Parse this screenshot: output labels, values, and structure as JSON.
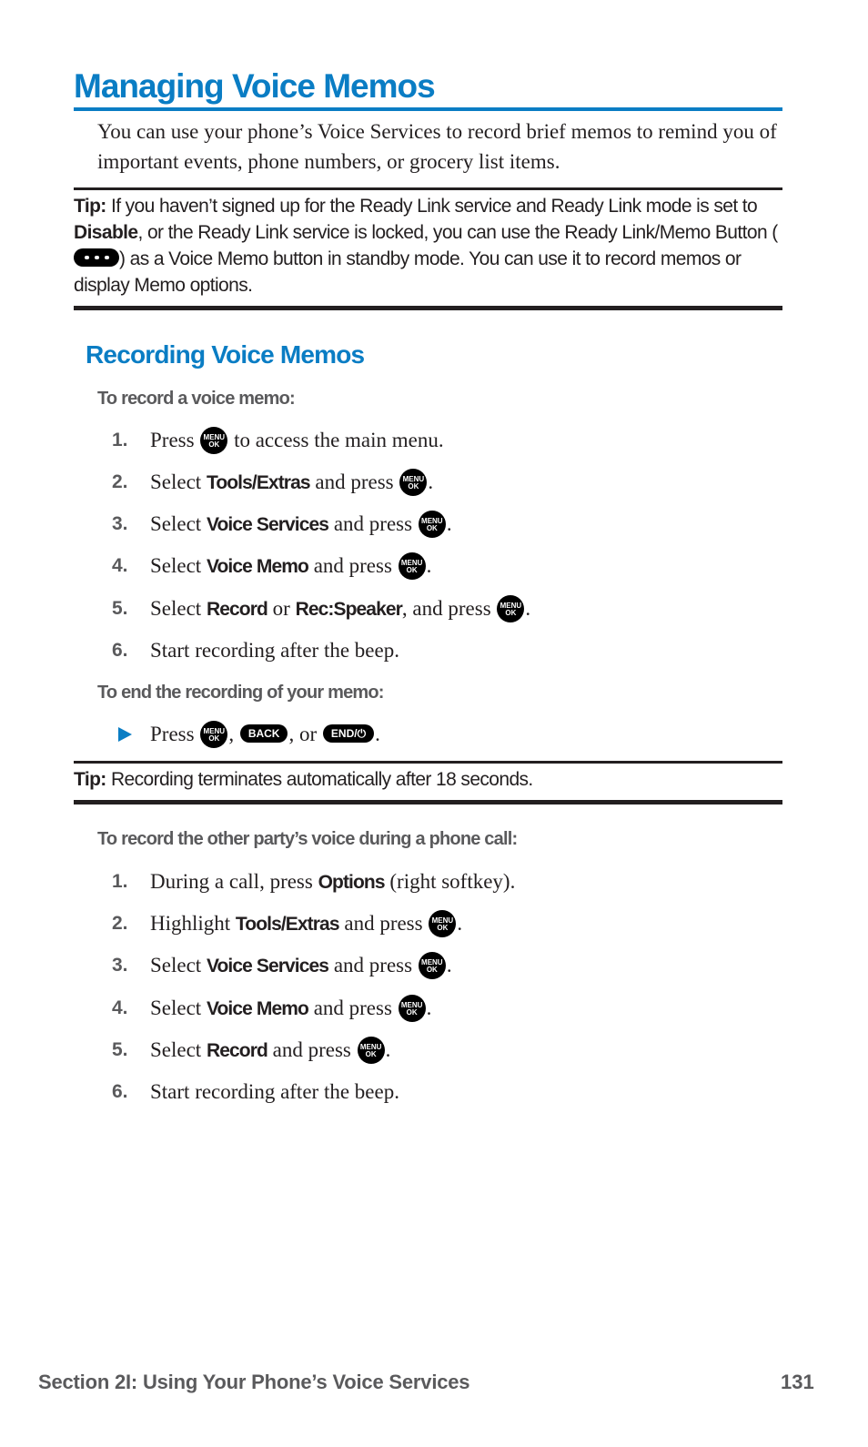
{
  "title": "Managing Voice Memos",
  "intro": "You can use your phone’s Voice Services to record brief memos to remind you of important events, phone numbers, or grocery list items.",
  "tip1": {
    "label": "Tip:",
    "part1": " If you haven’t signed up for the Ready Link service and Ready Link mode is set to ",
    "bold": "Disable",
    "part2": ", or the Ready Link service is locked, you can use the Ready Link/Memo Button (",
    "key_icon": "ready-link-memo-button-icon",
    "part3": ") as a Voice Memo button in standby mode. You can use it to record memos or display Memo options."
  },
  "section_heading": "Recording Voice Memos",
  "record": {
    "subheading": "To record a voice memo:",
    "steps": [
      {
        "num": "1.",
        "pre": "Press ",
        "post": " to access the main menu."
      },
      {
        "num": "2.",
        "pre": "Select ",
        "bold": "Tools/Extras",
        "mid": " and press ",
        "post": "."
      },
      {
        "num": "3.",
        "pre": "Select ",
        "bold": "Voice Services",
        "mid": " and press ",
        "post": "."
      },
      {
        "num": "4.",
        "pre": "Select ",
        "bold": "Voice Memo",
        "mid": " and press ",
        "post": "."
      },
      {
        "num": "5.",
        "pre": "Select ",
        "bold": "Record",
        "or": " or ",
        "bold2": "Rec:Speaker",
        "mid": ", and press ",
        "post": "."
      },
      {
        "num": "6.",
        "pre": "Start recording after the beep."
      }
    ]
  },
  "end": {
    "subheading": "To end the recording of your memo:",
    "bullet": {
      "pre": "Press ",
      "sep1": ", ",
      "sep2": ", or ",
      "post": "."
    }
  },
  "keys": {
    "menu_line1": "MENU",
    "menu_line2": "OK",
    "back": "BACK",
    "end": "END/⏻"
  },
  "tip2": {
    "label": "Tip:",
    "text": " Recording terminates automatically after 18 seconds."
  },
  "call": {
    "subheading": "To record the other party’s voice during a phone call:",
    "steps": [
      {
        "num": "1.",
        "pre": "During a call, press ",
        "bold": "Options",
        "post": " (right softkey)."
      },
      {
        "num": "2.",
        "pre": "Highlight ",
        "bold": "Tools/Extras",
        "mid": " and press ",
        "post": "."
      },
      {
        "num": "3.",
        "pre": "Select ",
        "bold": "Voice Services",
        "mid": " and press ",
        "post": "."
      },
      {
        "num": "4.",
        "pre": "Select ",
        "bold": "Voice Memo",
        "mid": " and press ",
        "post": "."
      },
      {
        "num": "5.",
        "pre": "Select ",
        "bold": "Record",
        "mid": " and press ",
        "post": "."
      },
      {
        "num": "6.",
        "pre": "Start recording after the beep."
      }
    ]
  },
  "footer": {
    "section": "Section 2I: Using Your Phone’s Voice Services",
    "page": "131"
  },
  "colors": {
    "accent": "#0a7dc4",
    "subheading": "#5a5a5c",
    "text": "#231f20"
  }
}
